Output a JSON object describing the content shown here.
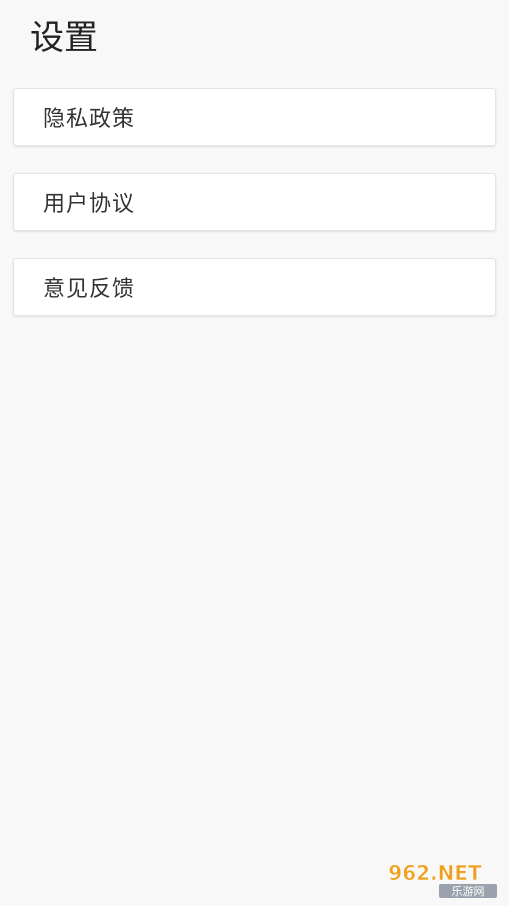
{
  "header": {
    "title": "设置"
  },
  "settings": {
    "items": [
      {
        "label": "隐私政策"
      },
      {
        "label": "用户协议"
      },
      {
        "label": "意见反馈"
      }
    ]
  },
  "watermark": {
    "top_text": "962.NET",
    "bottom_text": "乐游网"
  }
}
